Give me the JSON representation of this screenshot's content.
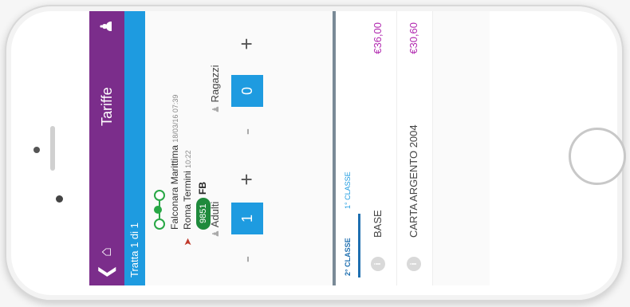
{
  "header": {
    "title": "Tariffe",
    "back_icon": "chevron-left-icon",
    "home_icon": "home-icon",
    "profile_icon": "person-settings-icon",
    "color": "#7b2d8b"
  },
  "subheader": {
    "text": "Tratta 1 di 1",
    "color": "#1e9be0"
  },
  "route": {
    "from_station": "Falconara Marittima",
    "from_time": "18/03/16 07:39",
    "to_station": "Roma Termini",
    "to_time": "10:22",
    "train_number": "9851",
    "train_category": "FB"
  },
  "passengers": {
    "adults_label": "Adulti",
    "adults_value": "1",
    "children_label": "Ragazzi",
    "children_value": "0",
    "minus": "-",
    "plus": "+"
  },
  "tabs": [
    {
      "label": "2° CLASSE",
      "active": true
    },
    {
      "label": "1° CLASSE",
      "active": false
    }
  ],
  "fares": [
    {
      "name": "BASE",
      "price": "€36,00",
      "info": "i"
    },
    {
      "name": "CARTA ARGENTO 2004",
      "price": "€30,60",
      "info": "i"
    }
  ],
  "accent_price_color": "#b22bb0"
}
